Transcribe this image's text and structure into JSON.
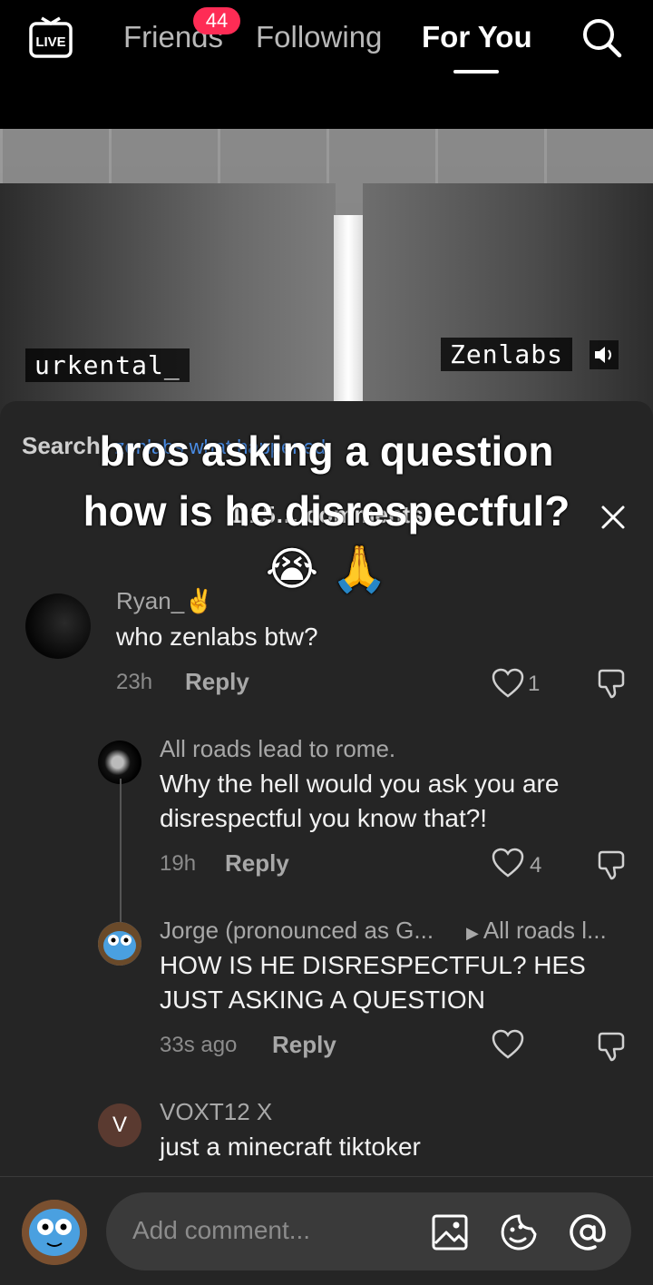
{
  "topbar": {
    "live_label": "LIVE",
    "tabs": [
      {
        "label": "Friends",
        "badge": "44"
      },
      {
        "label": "Following"
      },
      {
        "label": "For You",
        "active": true
      }
    ]
  },
  "video": {
    "left_tag": "urkental_",
    "right_tag": "Zenlabs"
  },
  "sheet": {
    "search_prefix": "Search:",
    "search_link": "zenlabs what happened",
    "comment_count": "1,15… comments",
    "caption_lines": [
      "bros asking a question",
      "how is he disrespectful?",
      "😭 🙏"
    ]
  },
  "comments": [
    {
      "username": "Ryan_✌️",
      "text": "who zenlabs btw?",
      "time": "23h",
      "reply": "Reply",
      "likes": "1"
    },
    {
      "username": "All roads lead to rome.",
      "text": "Why the hell would you ask you are disrespectful you know that?!",
      "time": "19h",
      "reply": "Reply",
      "likes": "4"
    },
    {
      "username": "Jorge (pronounced as G...",
      "reply_to": "All roads l...",
      "text": "HOW IS HE DISRESPECTFUL? HES JUST ASKING A QUESTION",
      "time": "33s ago",
      "reply": "Reply",
      "likes": ""
    },
    {
      "username": "VOXT12 X",
      "avatar_letter": "V",
      "text": "just a minecraft tiktoker"
    }
  ],
  "composer": {
    "placeholder": "Add comment..."
  },
  "colors": {
    "accent_badge": "#fe2c55",
    "link": "#4a8ee8",
    "sheet_bg": "#252525"
  }
}
